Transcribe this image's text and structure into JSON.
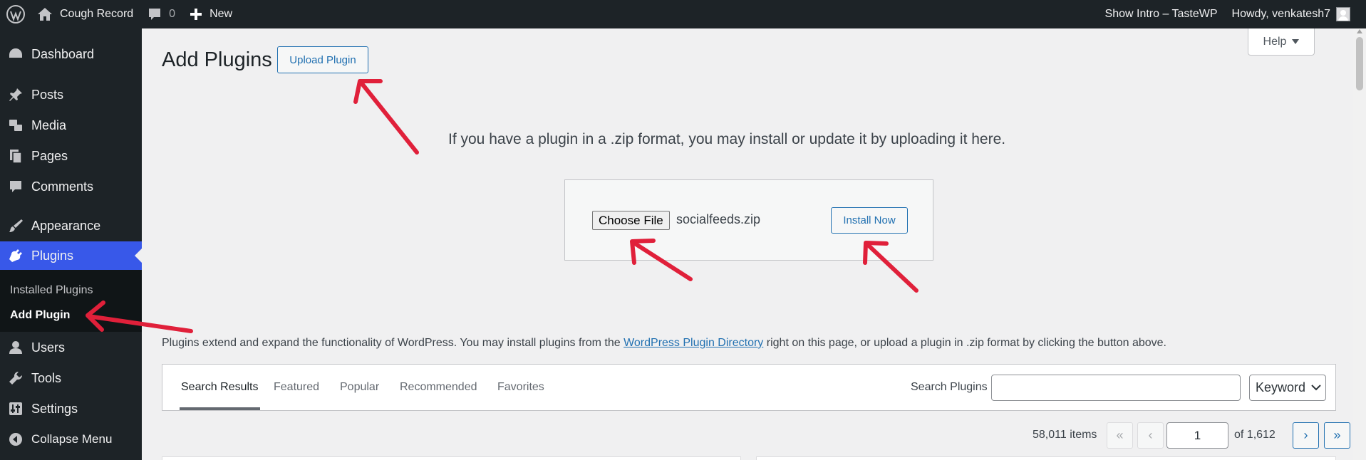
{
  "admin_bar": {
    "site_name": "Cough Record",
    "comments_count": "0",
    "new_label": "New",
    "show_intro": "Show Intro – TasteWP",
    "howdy": "Howdy, venkatesh7"
  },
  "sidebar": {
    "items": [
      {
        "label": "Dashboard",
        "icon": "dashboard-icon"
      },
      {
        "label": "Posts",
        "icon": "pin-icon"
      },
      {
        "label": "Media",
        "icon": "media-icon"
      },
      {
        "label": "Pages",
        "icon": "pages-icon"
      },
      {
        "label": "Comments",
        "icon": "comment-icon"
      },
      {
        "label": "Appearance",
        "icon": "brush-icon"
      },
      {
        "label": "Plugins",
        "icon": "plugin-icon"
      },
      {
        "label": "Users",
        "icon": "user-icon"
      },
      {
        "label": "Tools",
        "icon": "wrench-icon"
      },
      {
        "label": "Settings",
        "icon": "settings-icon"
      },
      {
        "label": "Collapse Menu",
        "icon": "collapse-icon"
      }
    ],
    "submenu": {
      "installed": "Installed Plugins",
      "add": "Add Plugin"
    }
  },
  "main": {
    "title": "Add Plugins",
    "upload_button": "Upload Plugin",
    "help": "Help",
    "upload_intro": "If you have a plugin in a .zip format, you may install or update it by uploading it here.",
    "choose_file": "Choose File",
    "file_name": "socialfeeds.zip",
    "install_now": "Install Now",
    "description_before": "Plugins extend and expand the functionality of WordPress. You may install plugins from the ",
    "description_link": "WordPress Plugin Directory",
    "description_after": " right on this page, or upload a plugin in .zip format by clicking the button above.",
    "tabs": [
      "Search Results",
      "Featured",
      "Popular",
      "Recommended",
      "Favorites"
    ],
    "search_label": "Search Plugins",
    "keyword": "Keyword",
    "items_count": "58,011 items",
    "page_current": "1",
    "page_of": "of 1,612",
    "pg_first": "«",
    "pg_prev": "‹",
    "pg_next": "›",
    "pg_last": "»"
  },
  "colors": {
    "admin_bg": "#1d2327",
    "accent": "#3858e9",
    "link": "#2271b1",
    "arrow": "#e0203a"
  }
}
